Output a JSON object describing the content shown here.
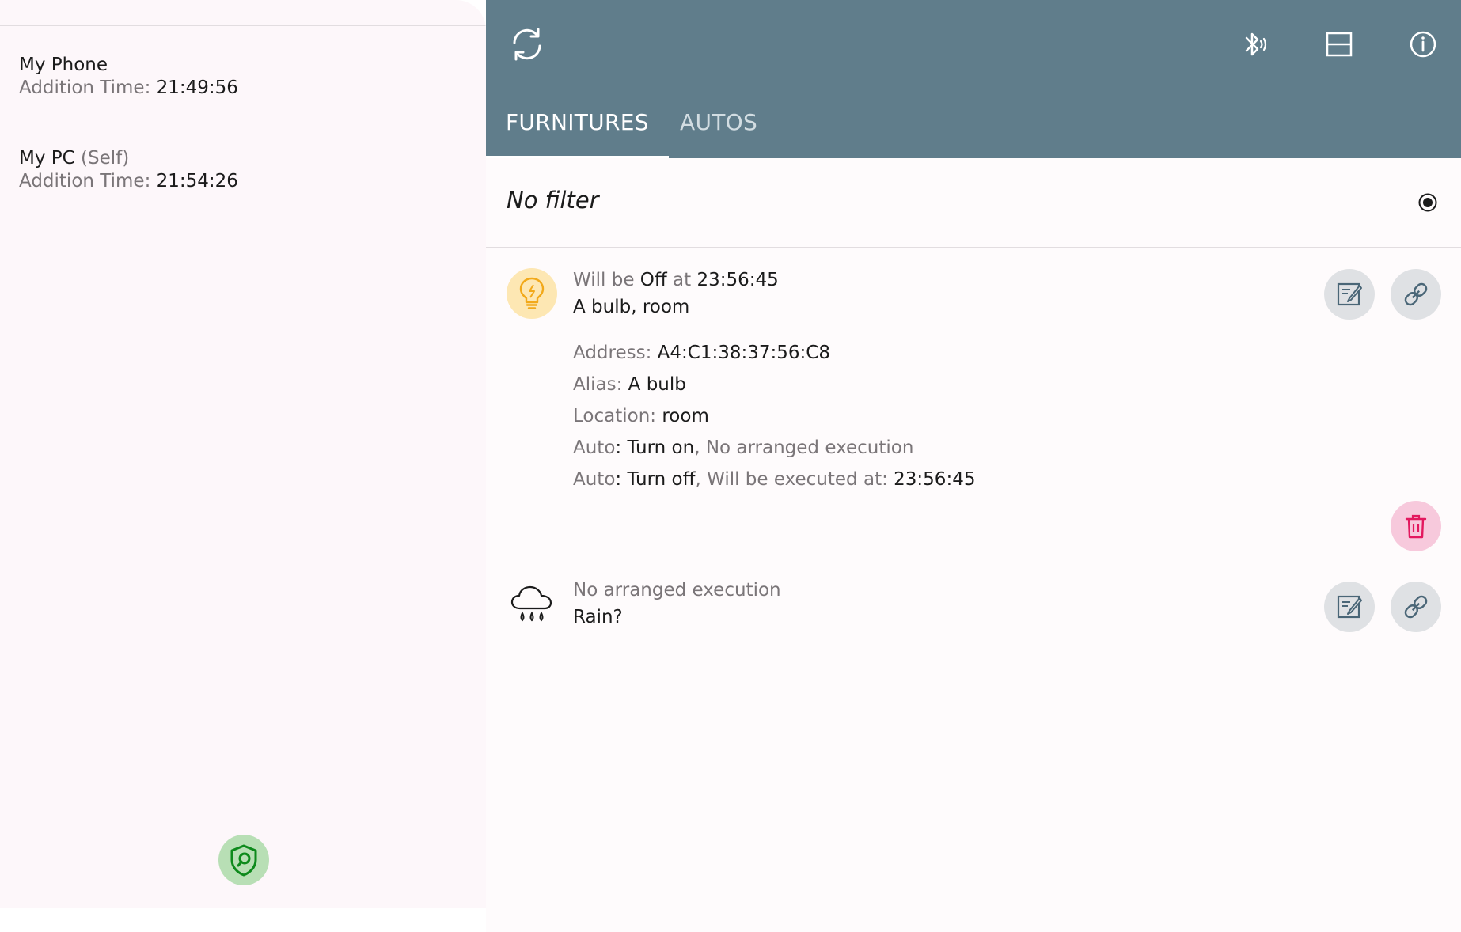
{
  "drawer": {
    "devices": [
      {
        "name": "My Phone",
        "self_tag": "",
        "time_label": "Addition Time: ",
        "time_value": "21:49:56"
      },
      {
        "name": "My PC",
        "self_tag": "(Self)",
        "time_label": "Addition Time: ",
        "time_value": "21:54:26"
      }
    ],
    "fab_icon": "shield-search-icon"
  },
  "appbar": {
    "icons": {
      "refresh": "refresh-icon",
      "bluetooth": "bluetooth-audio-icon",
      "view": "view-agenda-icon",
      "info": "info-icon"
    },
    "tabs": [
      {
        "label": "FURNITURES",
        "active": true
      },
      {
        "label": "AUTOS",
        "active": false
      }
    ],
    "color": "#607d8b"
  },
  "filter": {
    "label": "No filter",
    "selected": true
  },
  "items": [
    {
      "icon": "lightbulb-icon",
      "status": {
        "prefix": "Will be ",
        "state": "Off",
        "mid": " at ",
        "time": "23:56:45"
      },
      "title": "A bulb, room",
      "details": {
        "address": {
          "label": "Address: ",
          "value": "A4:C1:38:37:56:C8"
        },
        "alias": {
          "label": "Alias: ",
          "value": "A bulb"
        },
        "location": {
          "label": "Location: ",
          "value": "room"
        },
        "auto1": {
          "label": "Auto",
          "sep": ": ",
          "action": "Turn on",
          "rest": ", No arranged execution"
        },
        "auto2": {
          "label": "Auto",
          "sep": ": ",
          "action": "Turn off",
          "rest": ", Will be executed at: ",
          "time": "23:56:45"
        }
      }
    },
    {
      "icon": "rain-cloud-icon",
      "status_text": "No arranged execution",
      "title": "Rain?"
    }
  ],
  "colors": {
    "accent": "#607d8b",
    "bulb_bg": "#fde7b3",
    "bulb_stroke": "#f2a91a",
    "delete_bg": "#f7c9dc",
    "delete_stroke": "#e3195f",
    "fab_bg": "#b8dfb5",
    "fab_stroke": "#0e8a1c"
  }
}
